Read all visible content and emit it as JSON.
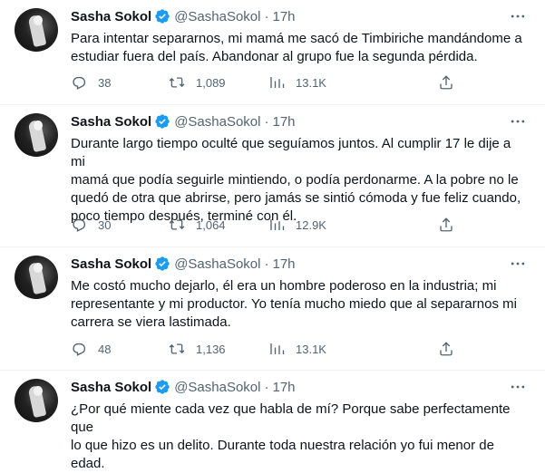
{
  "tweets": [
    {
      "name": "Sasha Sokol",
      "handle": "@SashaSokol",
      "dot": "·",
      "time": "17h",
      "text": "Para intentar separarnos, mi mamá me sacó de Timbiriche mandándome a\nestudiar fuera del país. Abandonar al grupo fue la segunda pérdida.",
      "replies": "38",
      "retweets": "1,089",
      "views": "13.1K"
    },
    {
      "name": "Sasha Sokol",
      "handle": "@SashaSokol",
      "dot": "·",
      "time": "17h",
      "text": "Durante largo tiempo oculté que seguíamos juntos. Al cumplir 17 le dije a mi\nmamá que podía seguirle mintiendo, o podía perdonarme. A la pobre no le\nquedó de otra que abrirse, pero jamás se sintió cómoda y fue feliz cuando,\npoco tiempo después, terminé con él.",
      "replies": "30",
      "retweets": "1,064",
      "views": "12.9K"
    },
    {
      "name": "Sasha Sokol",
      "handle": "@SashaSokol",
      "dot": "·",
      "time": "17h",
      "text": "Me costó mucho dejarlo, él era un hombre poderoso en la industria; mi\nrepresentante y mi productor. Yo tenía mucho miedo que al separarnos mi\ncarrera se viera lastimada.",
      "replies": "48",
      "retweets": "1,136",
      "views": "13.1K"
    },
    {
      "name": "Sasha Sokol",
      "handle": "@SashaSokol",
      "dot": "·",
      "time": "17h",
      "text": "¿Por qué miente cada vez que habla de mí? Porque sabe perfectamente que\nlo que hizo es un delito. Durante toda nuestra relación yo fui menor de\nedad."
    }
  ],
  "colors": {
    "verified": "#1d9bf0",
    "muted": "#536471",
    "text": "#0f1419",
    "divider": "#eff3f4"
  },
  "icons": [
    "verified-badge-icon",
    "more-icon",
    "reply-icon",
    "retweet-icon",
    "views-icon",
    "share-icon"
  ]
}
